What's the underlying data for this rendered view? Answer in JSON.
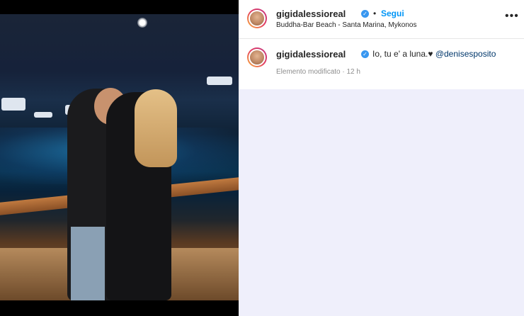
{
  "header": {
    "username": "gigidalessioreal",
    "separator": "•",
    "follow_label": "Segui",
    "location": "Buddha-Bar Beach - Santa Marina, Mykonos",
    "more_icon": "more-horizontal-icon",
    "verified_icon": "verified-badge-icon"
  },
  "post_caption": {
    "username": "gigidalessioreal",
    "text": "Io, tu e' a luna.♥",
    "mention": "@denisesposito",
    "meta": "Elemento modificato · 12 h"
  },
  "colors": {
    "accent": "#0095f6",
    "verified": "#3897f0",
    "panel_bg": "#efeffb"
  }
}
